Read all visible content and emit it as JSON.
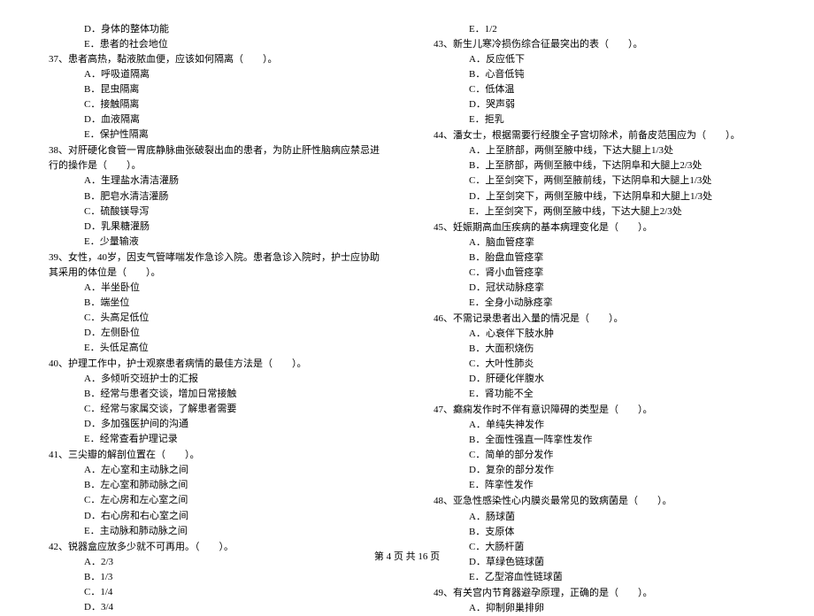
{
  "left": {
    "pre_options": [
      "D．身体的整体功能",
      "E．患者的社会地位"
    ],
    "questions": [
      {
        "num": "37、",
        "text": "患者高热，黏液脓血便，应该如何隔离（　　）。",
        "opts": [
          "A．呼吸道隔离",
          "B．昆虫隔离",
          "C．接触隔离",
          "D．血液隔离",
          "E．保护性隔离"
        ]
      },
      {
        "num": "38、",
        "text": "对肝硬化食管一胃底静脉曲张破裂出血的患者，为防止肝性脑病应禁忌进行的操作是（　　）。",
        "opts": [
          "A．生理盐水清洁灌肠",
          "B．肥皂水清洁灌肠",
          "C．硫酸镁导泻",
          "D．乳果糖灌肠",
          "E．少量输液"
        ]
      },
      {
        "num": "39、",
        "text": "女性，40岁，因支气管哮喘发作急诊入院。患者急诊入院时，护士应协助其采用的体位是（　　）。",
        "opts": [
          "A．半坐卧位",
          "B．端坐位",
          "C．头高足低位",
          "D．左侧卧位",
          "E．头低足高位"
        ]
      },
      {
        "num": "40、",
        "text": "护理工作中，护士观察患者病情的最佳方法是（　　）。",
        "opts": [
          "A．多倾听交班护士的汇报",
          "B．经常与患者交谈，增加日常接触",
          "C．经常与家属交谈，了解患者需要",
          "D．多加强医护间的沟通",
          "E．经常查看护理记录"
        ]
      },
      {
        "num": "41、",
        "text": "三尖瓣的解剖位置在（　　）。",
        "opts": [
          "A．左心室和主动脉之间",
          "B．左心室和肺动脉之间",
          "C．左心房和左心室之间",
          "D．右心房和右心室之间",
          "E．主动脉和肺动脉之间"
        ]
      },
      {
        "num": "42、",
        "text": "锐器盒应放多少就不可再用。（　　）。",
        "opts": [
          "A．2/3",
          "B．1/3",
          "C．1/4",
          "D．3/4"
        ]
      }
    ]
  },
  "right": {
    "pre_options": [
      "E．1/2"
    ],
    "questions": [
      {
        "num": "43、",
        "text": "新生儿寒冷损伤综合征最突出的表（　　）。",
        "opts": [
          "A．反应低下",
          "B．心音低钝",
          "C．低体温",
          "D．哭声弱",
          "E．拒乳"
        ]
      },
      {
        "num": "44、",
        "text": "潘女士，根据需要行经腹全子宫切除术，前备皮范围应为（　　）。",
        "opts": [
          "A．上至脐部，两侧至腋中线，下达大腿上1/3处",
          "B．上至脐部，两侧至腋中线，下达阴阜和大腿上2/3处",
          "C．上至剑突下，两侧至腋前线，下达阴阜和大腿上1/3处",
          "D．上至剑突下，两侧至腋中线，下达阴阜和大腿上1/3处",
          "E．上至剑突下，两侧至腋中线，下达大腿上2/3处"
        ]
      },
      {
        "num": "45、",
        "text": "妊娠期高血压疾病的基本病理变化是（　　）。",
        "opts": [
          "A．脑血管痉挛",
          "B．胎盘血管痉挛",
          "C．肾小血管痉挛",
          "D．冠状动脉痉挛",
          "E．全身小动脉痉挛"
        ]
      },
      {
        "num": "46、",
        "text": "不需记录患者出入量的情况是（　　）。",
        "opts": [
          "A．心衰伴下肢水肿",
          "B．大面积烧伤",
          "C．大叶性肺炎",
          "D．肝硬化伴腹水",
          "E．肾功能不全"
        ]
      },
      {
        "num": "47、",
        "text": "癫痫发作时不伴有意识障碍的类型是（　　）。",
        "opts": [
          "A．单纯失神发作",
          "B．全面性强直一阵挛性发作",
          "C．简单的部分发作",
          "D．复杂的部分发作",
          "E．阵挛性发作"
        ]
      },
      {
        "num": "48、",
        "text": "亚急性感染性心内膜炎最常见的致病菌是（　　）。",
        "opts": [
          "A．肠球菌",
          "B．支原体",
          "C．大肠杆菌",
          "D．草绿色链球菌",
          "E．乙型溶血性链球菌"
        ]
      },
      {
        "num": "49、",
        "text": "有关宫内节育器避孕原理，正确的是（　　）。",
        "opts": [
          "A．抑制卵巢排卵"
        ]
      }
    ]
  },
  "footer": "第 4 页 共 16 页"
}
